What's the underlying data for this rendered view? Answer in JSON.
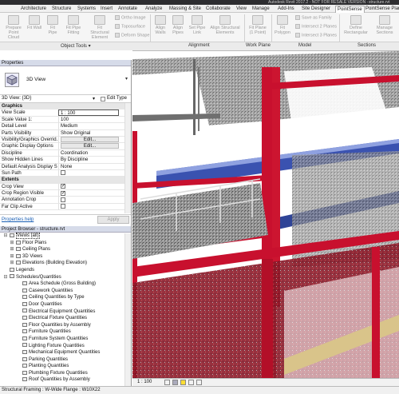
{
  "titlebar": {
    "app_title": "Autodesk Revit 2017.2 - NOT FOR RESALE VERSION -",
    "file_title": "structure.rvt"
  },
  "ribbon_tabs": [
    "Architecture",
    "Structure",
    "Systems",
    "Insert",
    "Annotate",
    "Analyze",
    "Massing & Site",
    "Collaborate",
    "View",
    "Manage",
    "Add-Ins",
    "Site Designer",
    "PointSense",
    "PointSense Plant"
  ],
  "active_tab": "PointSense",
  "ribbon": {
    "object_tools": {
      "prepare_point_cloud": "Prepare Point Cloud",
      "fit_wall": "Fit Wall",
      "fit_pipe": "Fit Pipe",
      "fit_pipe_fitting": "Fit Pipe Fitting",
      "fit_structural_element": "Fit Structural Element",
      "ortho_image": "Ortho Image",
      "topo_surface": "Toposurface",
      "deform_shape": "Deform Shape"
    },
    "alignment": {
      "align_walls": "Align Walls",
      "align_pipes": "Align Pipes",
      "set_pipe_link": "Set Pipe Link",
      "align_structural_elements": "Align Structural Elements"
    },
    "work_plane": {
      "fit_plane": "Fit Plane (1 Point)"
    },
    "model": {
      "fit_polygon": "Fit Polygon",
      "save_as_family": "Save as Family",
      "intersect_2_planes": "Intersect 2 Planes",
      "intersect_3_planes": "Intersect 3 Planes"
    },
    "sections": {
      "define_rectangular": "Define Rectangular",
      "manage": "Manage Sections"
    },
    "group_labels": {
      "object_tools": "Object Tools ▾",
      "alignment": "Alignment",
      "work_plane": "Work Plane",
      "model": "Model",
      "sections": "Sections"
    }
  },
  "properties": {
    "header": "Properties",
    "type_name": "3D View",
    "view_selector": "3D View: {3D}",
    "edit_type": "Edit Type",
    "rows": [
      {
        "group": "Graphics"
      },
      {
        "key": "View Scale",
        "value": "1 : 100",
        "boxed": true
      },
      {
        "key": "Scale Value   1:",
        "value": "100"
      },
      {
        "key": "Detail Level",
        "value": "Medium"
      },
      {
        "key": "Parts Visibility",
        "value": "Show Original"
      },
      {
        "key": "Visibility/Graphics Overrid...",
        "button": "Edit..."
      },
      {
        "key": "Graphic Display Options",
        "button": "Edit..."
      },
      {
        "key": "Discipline",
        "value": "Coordination"
      },
      {
        "key": "Show Hidden Lines",
        "value": "By Discipline"
      },
      {
        "key": "Default Analysis Display S...",
        "value": "None"
      },
      {
        "key": "Sun Path",
        "check": false
      },
      {
        "group": "Extents"
      },
      {
        "key": "Crop View",
        "check": true
      },
      {
        "key": "Crop Region Visible",
        "check": true
      },
      {
        "key": "Annotation Crop",
        "check": false
      },
      {
        "key": "Far Clip Active",
        "check": false
      }
    ],
    "help_link": "Properties help",
    "apply": "Apply"
  },
  "browser": {
    "header": "Project Browser - structure.rvt",
    "items": [
      {
        "level": 0,
        "toggle": "⊟",
        "label": "Views (all)",
        "boxed": true
      },
      {
        "level": 1,
        "toggle": "⊞",
        "label": "Floor Plans"
      },
      {
        "level": 1,
        "toggle": "⊞",
        "label": "Ceiling Plans"
      },
      {
        "level": 1,
        "toggle": "⊞",
        "label": "3D Views"
      },
      {
        "level": 1,
        "toggle": "⊞",
        "label": "Elevations (Building Elevation)"
      },
      {
        "level": 0,
        "toggle": "",
        "label": "Legends"
      },
      {
        "level": 0,
        "toggle": "⊟",
        "label": "Schedules/Quantities"
      },
      {
        "level": 2,
        "toggle": "",
        "label": "Area Schedule (Gross Building)"
      },
      {
        "level": 2,
        "toggle": "",
        "label": "Casework Quantities"
      },
      {
        "level": 2,
        "toggle": "",
        "label": "Ceiling Quantities by Type"
      },
      {
        "level": 2,
        "toggle": "",
        "label": "Door Quantities"
      },
      {
        "level": 2,
        "toggle": "",
        "label": "Electrical Equipment Quantities"
      },
      {
        "level": 2,
        "toggle": "",
        "label": "Electrical Fixture Quantities"
      },
      {
        "level": 2,
        "toggle": "",
        "label": "Floor Quantities by Assembly"
      },
      {
        "level": 2,
        "toggle": "",
        "label": "Furniture Quantities"
      },
      {
        "level": 2,
        "toggle": "",
        "label": "Furniture System Quantities"
      },
      {
        "level": 2,
        "toggle": "",
        "label": "Lighting Fixture Quantities"
      },
      {
        "level": 2,
        "toggle": "",
        "label": "Mechanical Equipment Quantities"
      },
      {
        "level": 2,
        "toggle": "",
        "label": "Parking Quantities"
      },
      {
        "level": 2,
        "toggle": "",
        "label": "Planting Quantities"
      },
      {
        "level": 2,
        "toggle": "",
        "label": "Plumbing Fixture Quantities"
      },
      {
        "level": 2,
        "toggle": "",
        "label": "Roof Quantities by Assembly"
      }
    ]
  },
  "view_control": {
    "scale": "1 : 100"
  },
  "statusbar": {
    "text": "Structural Framing : W-Wide Flange : W10X22"
  },
  "colors": {
    "steel_red": "#c8102e",
    "pipe_blue": "#3a52b0",
    "cloud_gray": "#8e8e8e",
    "timber": "#d9c48a"
  }
}
